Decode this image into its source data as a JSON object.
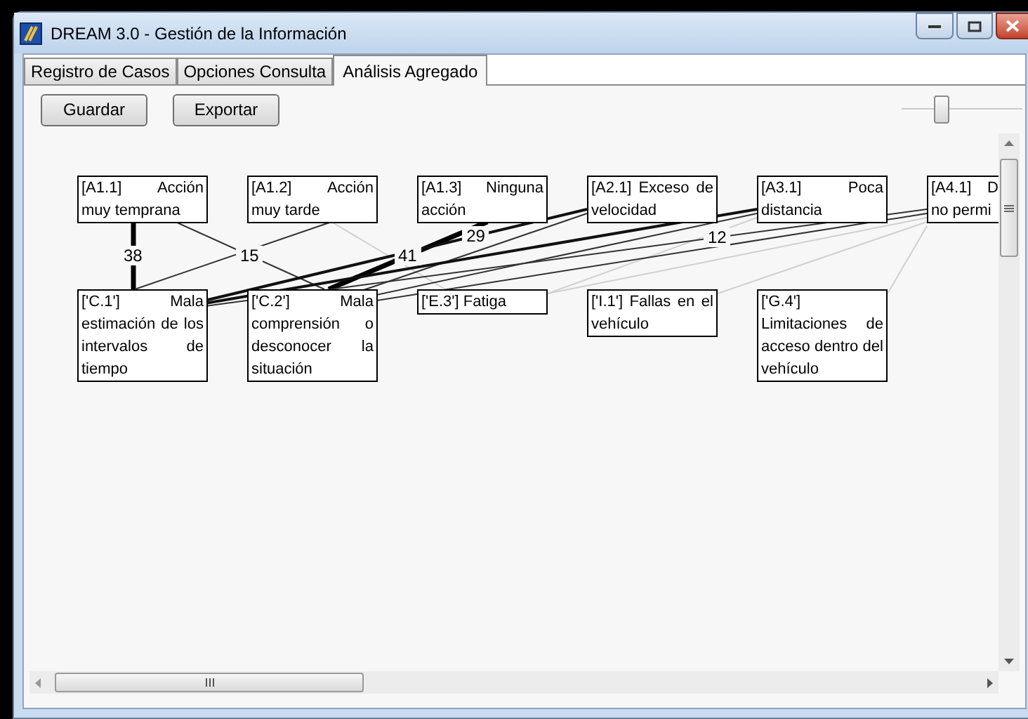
{
  "window": {
    "title": "DREAM 3.0 - Gestión de la Información"
  },
  "tabs": [
    {
      "label": "Registro de Casos",
      "selected": false
    },
    {
      "label": "Opciones Consulta",
      "selected": false
    },
    {
      "label": "Análisis Agregado",
      "selected": true
    }
  ],
  "toolbar": {
    "buttons": [
      "Guardar",
      "Exportar"
    ],
    "zoom_slider": {
      "level": 0.3
    }
  },
  "diagram": {
    "top_nodes": [
      {
        "text": "[A1.1] Acción muy temprana",
        "links": [
          {
            "kind": "heavy",
            "label": "38"
          },
          {
            "kind": "thin",
            "label": "15"
          },
          {
            "kind": "none"
          },
          {
            "kind": "none"
          },
          {
            "kind": "none"
          }
        ]
      },
      {
        "text": "[A1.2] Acción muy tarde",
        "links": [
          {
            "kind": "thin"
          },
          {
            "kind": "none"
          },
          {
            "kind": "faint"
          },
          {
            "kind": "none"
          },
          {
            "kind": "none"
          }
        ]
      },
      {
        "text": "[A1.3] Ninguna acción",
        "links": [
          {
            "kind": "none"
          },
          {
            "kind": "heavy",
            "label": "41"
          },
          {
            "kind": "none"
          },
          {
            "kind": "none"
          },
          {
            "kind": "none"
          }
        ]
      },
      {
        "text": "[A2.1] Exceso de velocidad",
        "links": [
          {
            "kind": "medium",
            "label": "29"
          },
          {
            "kind": "thin"
          },
          {
            "kind": "none"
          },
          {
            "kind": "none"
          },
          {
            "kind": "none"
          }
        ]
      },
      {
        "text": "[A3.1] Poca distancia",
        "links": [
          {
            "kind": "medium"
          },
          {
            "kind": "thin"
          },
          {
            "kind": "faint"
          },
          {
            "kind": "none"
          },
          {
            "kind": "none"
          }
        ]
      },
      {
        "text": "[A4.1] D no permi",
        "links": [
          {
            "kind": "thin",
            "label": "12"
          },
          {
            "kind": "thin"
          },
          {
            "kind": "faint"
          },
          {
            "kind": "faint"
          },
          {
            "kind": "faint"
          }
        ]
      }
    ],
    "bottom_nodes": [
      {
        "text": "['C.1'] Mala estimación de los intervalos de tiempo"
      },
      {
        "text": "['C.2'] Mala comprensión o desconocer la situación"
      },
      {
        "text": "['E.3'] Fatiga"
      },
      {
        "text": "['I.1'] Fallas en el vehículo"
      },
      {
        "text": "['G.4'] Limitaciones de acceso dentro del vehículo"
      }
    ]
  }
}
